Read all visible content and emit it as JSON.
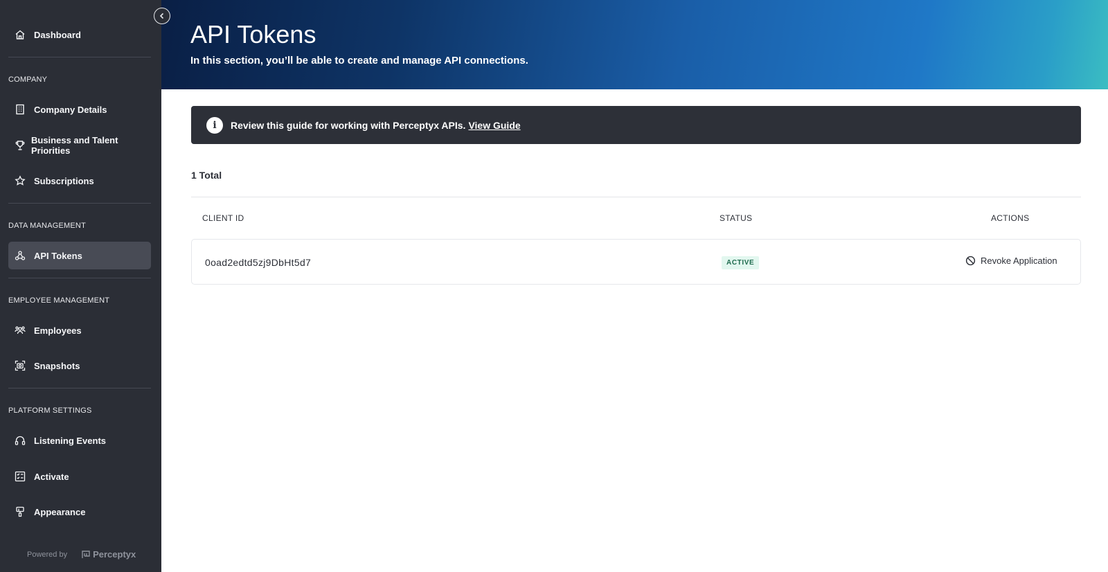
{
  "sidebar": {
    "dashboard": "Dashboard",
    "sections": {
      "company": "COMPANY",
      "data_management": "DATA MANAGEMENT",
      "employee_management": "EMPLOYEE MANAGEMENT",
      "platform_settings": "PLATFORM SETTINGS"
    },
    "items": {
      "company_details": "Company Details",
      "business_talent": "Business and Talent Priorities",
      "subscriptions": "Subscriptions",
      "api_tokens": "API Tokens",
      "employees": "Employees",
      "snapshots": "Snapshots",
      "listening_events": "Listening Events",
      "activate": "Activate",
      "appearance": "Appearance"
    },
    "active_item": "api_tokens",
    "powered_by": "Powered by",
    "brand": "Perceptyx"
  },
  "header": {
    "title": "API Tokens",
    "subtitle": "In this section, you’ll be able to create and manage API connections."
  },
  "banner": {
    "text": "Review this guide for working with Perceptyx APIs.",
    "link": "View Guide"
  },
  "total_label": "1 Total",
  "table": {
    "columns": [
      "CLIENT ID",
      "STATUS",
      "ACTIONS"
    ],
    "rows": [
      {
        "client_id": "0oad2edtd5zj9DbHt5d7",
        "status": "ACTIVE",
        "action": "Revoke Application"
      }
    ]
  },
  "colors": {
    "sidebar_bg": "#2b2e36",
    "active_item_bg": "#484b55",
    "banner_bg": "#2d3038",
    "status_active_bg": "#e2f7ef",
    "status_active_text": "#1f6b4e"
  }
}
